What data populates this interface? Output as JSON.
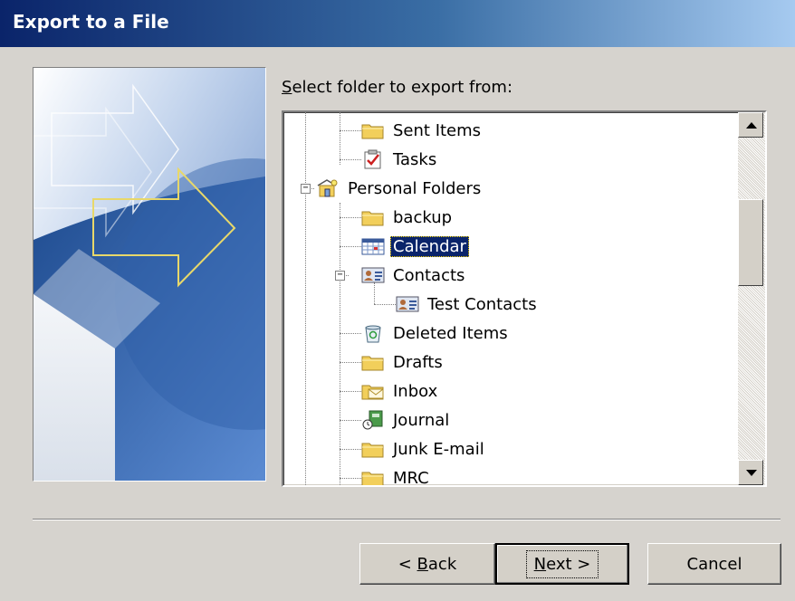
{
  "window": {
    "title": "Export to a File"
  },
  "prompt": {
    "prefix": "S",
    "rest": "elect folder to export from:"
  },
  "tree": {
    "items": [
      {
        "label": "Sent Items",
        "icon": "folder-icon"
      },
      {
        "label": "Tasks",
        "icon": "tasks-icon"
      },
      {
        "label": "Personal Folders",
        "icon": "personal-folders-icon"
      },
      {
        "label": "backup",
        "icon": "folder-icon"
      },
      {
        "label": "Calendar",
        "icon": "calendar-icon",
        "selected": true
      },
      {
        "label": "Contacts",
        "icon": "contacts-icon"
      },
      {
        "label": "Test Contacts",
        "icon": "contacts-icon"
      },
      {
        "label": "Deleted Items",
        "icon": "deleted-items-icon"
      },
      {
        "label": "Drafts",
        "icon": "folder-icon"
      },
      {
        "label": "Inbox",
        "icon": "inbox-icon"
      },
      {
        "label": "Journal",
        "icon": "journal-icon"
      },
      {
        "label": "Junk E-mail",
        "icon": "folder-icon"
      },
      {
        "label": "MRC",
        "icon": "folder-icon"
      }
    ]
  },
  "buttons": {
    "back": {
      "prefix": "< ",
      "accel": "B",
      "rest": "ack"
    },
    "next": {
      "accel": "N",
      "rest": "ext >"
    },
    "cancel": {
      "label": "Cancel"
    }
  },
  "colors": {
    "titlebar_start": "#0a246a",
    "titlebar_end": "#a6caf0",
    "selection": "#0a246a",
    "dialog_bg": "#d6d3ce"
  }
}
